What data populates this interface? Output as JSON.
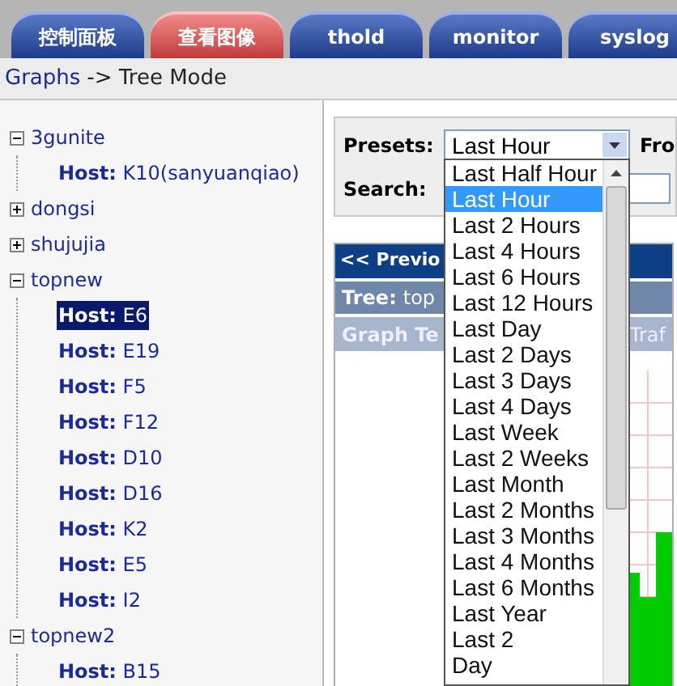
{
  "tabs": [
    {
      "label": "控制面板",
      "selected": false
    },
    {
      "label": "查看图像",
      "selected": true
    },
    {
      "label": "thold",
      "selected": false
    },
    {
      "label": "monitor",
      "selected": false
    },
    {
      "label": "syslog",
      "selected": false
    }
  ],
  "breadcrumb": {
    "link": "Graphs",
    "text": "-> Tree Mode"
  },
  "tree": [
    {
      "label": "3gunite",
      "expanded": true,
      "children": [
        {
          "prefix": "Host:",
          "label": "K10(sanyuanqiao)",
          "selected": false
        }
      ]
    },
    {
      "label": "dongsi",
      "expanded": false
    },
    {
      "label": "shujujia",
      "expanded": false
    },
    {
      "label": "topnew",
      "expanded": true,
      "children": [
        {
          "prefix": "Host:",
          "label": "E6",
          "selected": true
        },
        {
          "prefix": "Host:",
          "label": "E19",
          "selected": false
        },
        {
          "prefix": "Host:",
          "label": "F5",
          "selected": false
        },
        {
          "prefix": "Host:",
          "label": "F12",
          "selected": false
        },
        {
          "prefix": "Host:",
          "label": "D10",
          "selected": false
        },
        {
          "prefix": "Host:",
          "label": "D16",
          "selected": false
        },
        {
          "prefix": "Host:",
          "label": "K2",
          "selected": false
        },
        {
          "prefix": "Host:",
          "label": "E5",
          "selected": false
        },
        {
          "prefix": "Host:",
          "label": "I2",
          "selected": false
        }
      ]
    },
    {
      "label": "topnew2",
      "expanded": true,
      "children": [
        {
          "prefix": "Host:",
          "label": "B15",
          "selected": false
        }
      ]
    }
  ],
  "filters": {
    "presets_label": "Presets:",
    "presets_value": "Last Hour",
    "from_label": "Fro",
    "search_label": "Search:",
    "options": [
      {
        "label": "Last Half Hour",
        "selected": false
      },
      {
        "label": "Last Hour",
        "selected": true
      },
      {
        "label": "Last 2 Hours",
        "selected": false
      },
      {
        "label": "Last 4 Hours",
        "selected": false
      },
      {
        "label": "Last 6 Hours",
        "selected": false
      },
      {
        "label": "Last 12 Hours",
        "selected": false
      },
      {
        "label": "Last Day",
        "selected": false
      },
      {
        "label": "Last 2 Days",
        "selected": false
      },
      {
        "label": "Last 3 Days",
        "selected": false
      },
      {
        "label": "Last 4 Days",
        "selected": false
      },
      {
        "label": "Last Week",
        "selected": false
      },
      {
        "label": "Last 2 Weeks",
        "selected": false
      },
      {
        "label": "Last Month",
        "selected": false
      },
      {
        "label": "Last 2 Months",
        "selected": false
      },
      {
        "label": "Last 3 Months",
        "selected": false
      },
      {
        "label": "Last 4 Months",
        "selected": false
      },
      {
        "label": "Last 6 Months",
        "selected": false
      },
      {
        "label": "Last Year",
        "selected": false
      },
      {
        "label": "Last 2",
        "selected": false
      },
      {
        "label": "Day",
        "selected": false
      }
    ]
  },
  "graph_panel": {
    "previous": "<< Previo",
    "tree_prefix": "Tree:",
    "tree_value": "top",
    "graph_template": "Graph Te",
    "column_2": "Traf"
  }
}
